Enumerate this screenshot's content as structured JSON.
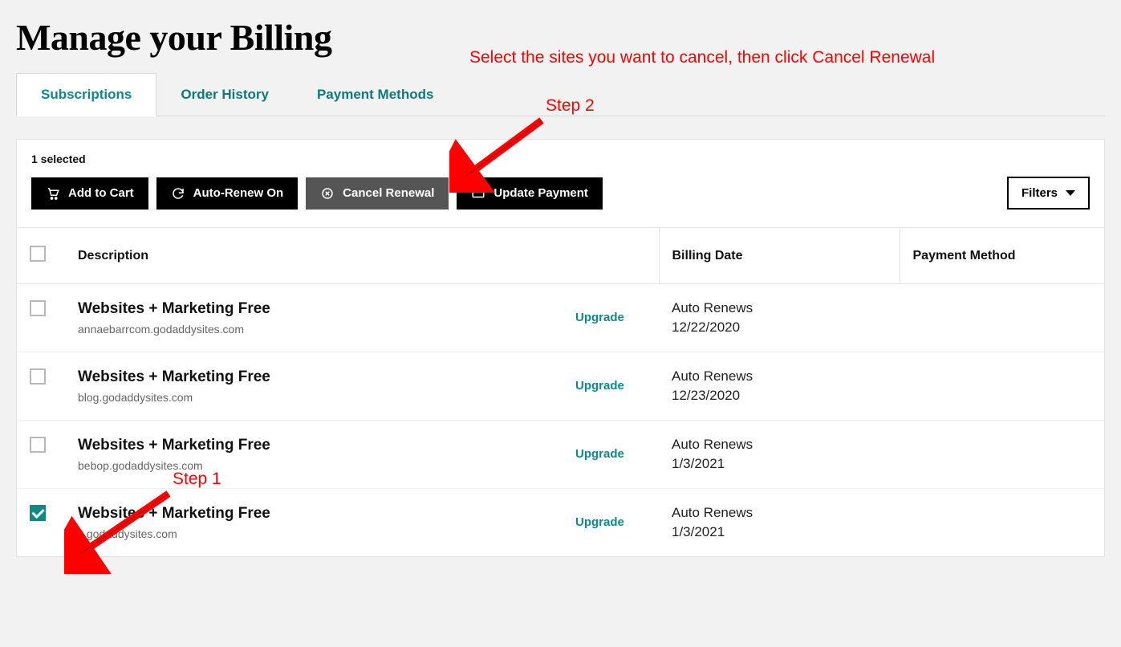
{
  "page": {
    "title": "Manage your Billing"
  },
  "tabs": {
    "subscriptions": "Subscriptions",
    "order_history": "Order History",
    "payment_methods": "Payment Methods"
  },
  "toolbar": {
    "selected_text": "1 selected",
    "add_to_cart": "Add to Cart",
    "auto_renew_on": "Auto-Renew On",
    "cancel_renewal": "Cancel Renewal",
    "update_payment": "Update Payment",
    "filters": "Filters"
  },
  "columns": {
    "description": "Description",
    "billing_date": "Billing Date",
    "payment_method": "Payment Method"
  },
  "rows": [
    {
      "checked": false,
      "title": "Websites + Marketing Free",
      "sub": "annaebarrcom.godaddysites.com",
      "upgrade": "Upgrade",
      "billing_label": "Auto Renews",
      "billing_date": "12/22/2020"
    },
    {
      "checked": false,
      "title": "Websites + Marketing Free",
      "sub": "blog.godaddysites.com",
      "upgrade": "Upgrade",
      "billing_label": "Auto Renews",
      "billing_date": "12/23/2020"
    },
    {
      "checked": false,
      "title": "Websites + Marketing Free",
      "sub": "bebop.godaddysites.com",
      "upgrade": "Upgrade",
      "billing_label": "Auto Renews",
      "billing_date": "1/3/2021"
    },
    {
      "checked": true,
      "title": "Websites + Marketing Free",
      "sub": "k.godaddysites.com",
      "upgrade": "Upgrade",
      "billing_label": "Auto Renews",
      "billing_date": "1/3/2021"
    }
  ],
  "annotations": {
    "main": "Select the sites you want to cancel, then click Cancel Renewal",
    "step1": "Step 1",
    "step2": "Step 2"
  }
}
